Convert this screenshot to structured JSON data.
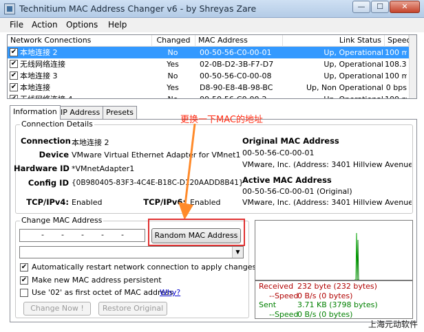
{
  "window": {
    "title": "Technitium MAC Address Changer v6 - by Shreyas Zare",
    "minimize": "—",
    "maximize": "☐",
    "close": "✕"
  },
  "menu": {
    "file": "File",
    "action": "Action",
    "options": "Options",
    "help": "Help"
  },
  "connections": {
    "columns": [
      "Network Connections",
      "Changed",
      "MAC Address",
      "Link Status",
      "Speed"
    ],
    "rows": [
      {
        "checked": "✔",
        "name": "本地连接 2",
        "changed": "No",
        "mac": "00-50-56-C0-00-01",
        "link": "Up, Operational",
        "speed": "100 mbps"
      },
      {
        "checked": "✔",
        "name": "无线网络连接",
        "changed": "Yes",
        "mac": "02-0B-D2-3B-F7-D7",
        "link": "Up, Operational",
        "speed": "108.3 m"
      },
      {
        "checked": "✔",
        "name": "本地连接 3",
        "changed": "No",
        "mac": "00-50-56-C0-00-08",
        "link": "Up, Operational",
        "speed": "100 mbps"
      },
      {
        "checked": "✔",
        "name": "本地连接",
        "changed": "Yes",
        "mac": "D8-90-E8-4B-98-BC",
        "link": "Up, Non Operational",
        "speed": "0 bps"
      },
      {
        "checked": "✔",
        "name": "无线网络连接 4",
        "changed": "No",
        "mac": "00-50-56-C0-00-2",
        "link": "Up, Operational",
        "speed": "100 m"
      }
    ],
    "selected_index": 0
  },
  "tabs": {
    "information": "Information",
    "ip_address": "IP Address",
    "presets": "Presets"
  },
  "details": {
    "title": "Connection Details",
    "connection_label": "Connection",
    "connection_value": "本地连接 2",
    "device_label": "Device",
    "device_value": "VMware Virtual Ethernet Adapter for VMnet1",
    "hardware_label": "Hardware ID",
    "hardware_value": "*VMnetAdapter1",
    "config_label": "Config ID",
    "config_value": "{0B980405-83F3-4C4E-B18C-D120AADD8B41}",
    "tcpv4_label": "TCP/IPv4:",
    "tcpv4_value": "Enabled",
    "tcpv6_label": "TCP/IPv6:",
    "tcpv6_value": "Enabled",
    "original_heading": "Original MAC Address",
    "original_mac": "00-50-56-C0-00-01",
    "original_vendor": "VMware, Inc.  (Address: 3401 Hillview Avenue, PAl",
    "active_heading": "Active MAC Address",
    "active_mac": "00-50-56-C0-00-01 (Original)",
    "active_vendor": "VMware, Inc.  (Address: 3401 Hillview Avenue, PAl"
  },
  "change": {
    "title": "Change MAC Address",
    "mac_segments": [
      "-",
      "-",
      "-",
      "-",
      "-"
    ],
    "random_button": "Random MAC Address",
    "auto_restart_label": "Automatically restart network connection to apply changes",
    "auto_restart_checked": "✔",
    "persistent_label": "Make new MAC address persistent",
    "persistent_checked": "✔",
    "use02_label": "Use '02' as first octet of MAC address",
    "use02_checked": "",
    "why_link": "Why?",
    "change_button": "Change Now !",
    "restore_button": "Restore Original"
  },
  "traffic": {
    "received_label": "Received",
    "received_value": "232 byte (232 bytes)",
    "recv_speed_label": "--Speed",
    "recv_speed_value": "0 B/s (0 bytes)",
    "sent_label": "Sent",
    "sent_value": "3.71 KB (3798 bytes)",
    "sent_speed_label": "--Speed",
    "sent_speed_value": "0 B/s (0 bytes)",
    "colors": {
      "received": "#b00000",
      "sent": "#008000"
    }
  },
  "annotation": {
    "text": "更换一下MAC的地址",
    "color": "#ff2b12"
  },
  "watermark": "上海元动软件"
}
